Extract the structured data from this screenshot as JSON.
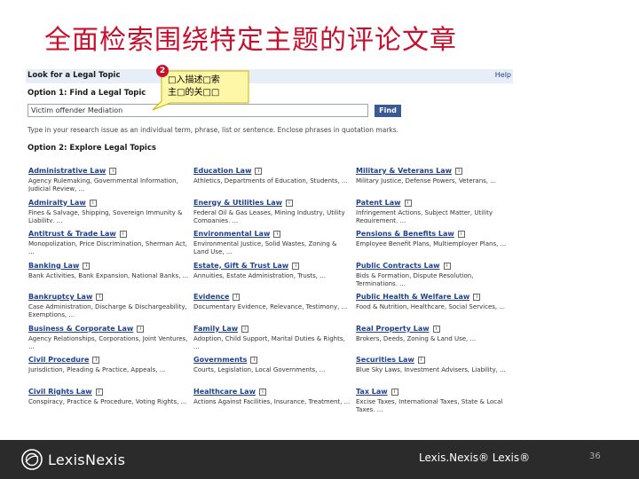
{
  "slide": {
    "title": "全面检索围绕特定主题的评论文章",
    "footer_brand": "Lexis.Nexis® Lexis®",
    "page_number": "36",
    "logo_text": "LexisNexis",
    "title_color": "#c8102e"
  },
  "callout": {
    "step": "2",
    "line1": "□入描述□索",
    "line2": "主□的关□□"
  },
  "panel": {
    "header": "Look for a Legal Topic",
    "help": "Help",
    "option1_label": "Option 1:  Find a Legal Topic",
    "search_value": "Victim offender Mediation",
    "find_button": "Find",
    "hint": "Type in your research issue as an individual term, phrase, list or sentence. Enclose phrases in quotation marks.",
    "option2_label": "Option 2:  Explore Legal Topics",
    "columns": [
      [
        {
          "title": "Administrative Law",
          "desc": "Agency Rulemaking, Governmental Information, Judicial Review, ..."
        },
        {
          "title": "Admiralty Law",
          "desc": "Fines & Salvage, Shipping, Sovereign Immunity & Liability, ..."
        },
        {
          "title": "Antitrust & Trade Law",
          "desc": "Monopolization, Price Discrimination, Sherman Act, ..."
        },
        {
          "title": "Banking Law",
          "desc": "Bank Activities, Bank Expansion, National Banks, ..."
        },
        {
          "title": "Bankruptcy Law",
          "desc": "Case Administration, Discharge & Dischargeability, Exemptions, ..."
        },
        {
          "title": "Business & Corporate Law",
          "desc": "Agency Relationships, Corporations, Joint Ventures, ..."
        },
        {
          "title": "Civil Procedure",
          "desc": "Jurisdiction, Pleading & Practice, Appeals, ..."
        },
        {
          "title": "Civil Rights Law",
          "desc": "Conspiracy, Practice & Procedure, Voting Rights, ..."
        }
      ],
      [
        {
          "title": "Education Law",
          "desc": "Athletics, Departments of Education, Students, ..."
        },
        {
          "title": "Energy & Utilities Law",
          "desc": "Federal Oil & Gas Leases, Mining Industry, Utility Companies, ..."
        },
        {
          "title": "Environmental Law",
          "desc": "Environmental Justice, Solid Wastes, Zoning & Land Use, ..."
        },
        {
          "title": "Estate, Gift & Trust Law",
          "desc": "Annuities, Estate Administration, Trusts, ..."
        },
        {
          "title": "Evidence",
          "desc": "Documentary Evidence, Relevance, Testimony, ..."
        },
        {
          "title": "Family Law",
          "desc": "Adoption, Child Support, Marital Duties & Rights, ..."
        },
        {
          "title": "Governments",
          "desc": "Courts, Legislation, Local Governments, ..."
        },
        {
          "title": "Healthcare Law",
          "desc": "Actions Against Facilities, Insurance, Treatment, ..."
        }
      ],
      [
        {
          "title": "Military & Veterans Law",
          "desc": "Military Justice, Defense Powers, Veterans, ..."
        },
        {
          "title": "Patent Law",
          "desc": "Infringement Actions, Subject Matter, Utility Requirement, ..."
        },
        {
          "title": "Pensions & Benefits Law",
          "desc": "Employee Benefit Plans, Multiemployer Plans, ..."
        },
        {
          "title": "Public Contracts Law",
          "desc": "Bids & Formation, Dispute Resolution, Terminations, ..."
        },
        {
          "title": "Public Health & Welfare Law",
          "desc": "Food & Nutrition, Healthcare, Social Services, ..."
        },
        {
          "title": "Real Property Law",
          "desc": "Brokers, Deeds, Zoning & Land Use, ..."
        },
        {
          "title": "Securities Law",
          "desc": "Blue Sky Laws, Investment Advisers, Liability, ..."
        },
        {
          "title": "Tax Law",
          "desc": "Excise Taxes, International Taxes, State & Local Taxes, ..."
        }
      ]
    ]
  }
}
